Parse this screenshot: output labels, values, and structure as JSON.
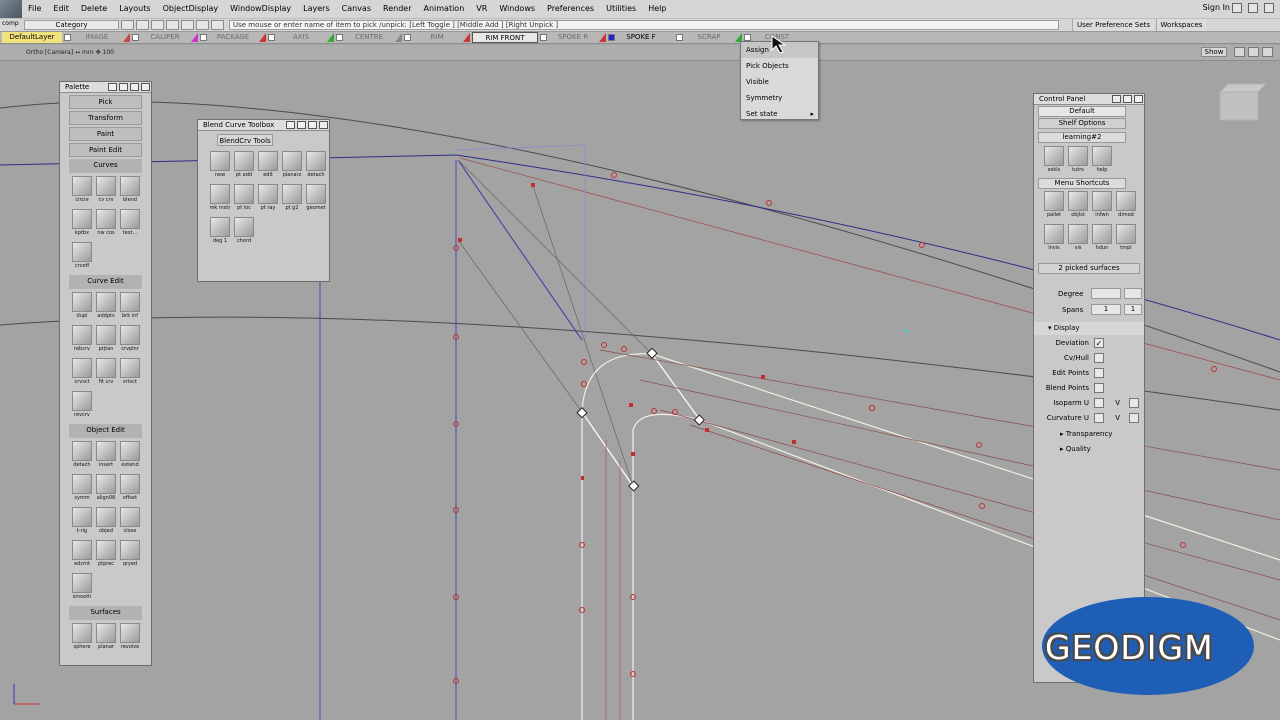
{
  "menubar": {
    "items": [
      "File",
      "Edit",
      "Delete",
      "Layouts",
      "ObjectDisplay",
      "WindowDisplay",
      "Layers",
      "Canvas",
      "Render",
      "Animation",
      "VR",
      "Windows",
      "Preferences",
      "Utilities",
      "Help"
    ],
    "sign_in": "Sign In"
  },
  "toolbar": {
    "comp_label": "comp",
    "category": "Category",
    "hint": "Use mouse or enter name of item to pick /unpick: [Left Toggle ] [Middle Add ] [Right Unpick ]",
    "user_pref_sets": "User Preference Sets",
    "workspaces": "Workspaces"
  },
  "layers": [
    {
      "label": "DefaultLayer",
      "color": "#f2e27b"
    },
    {
      "label": "IMAGE",
      "color": "#c44"
    },
    {
      "label": "CALIPER",
      "color": "#c3c"
    },
    {
      "label": "PACKAGE",
      "color": "#c33"
    },
    {
      "label": "AXIS",
      "color": "#3a3"
    },
    {
      "label": "CENTRE",
      "color": "#888"
    },
    {
      "label": "RIM",
      "color": "#c33"
    },
    {
      "label": "RIM FRONT",
      "color": "#888"
    },
    {
      "label": "SPOKE R",
      "color": "#c33"
    },
    {
      "label": "SPOKE F",
      "color": "#22c"
    },
    {
      "label": "SCRAP",
      "color": "#3a3"
    },
    {
      "label": "CONST",
      "color": "#888"
    }
  ],
  "viewport": {
    "label": "Ortho [Camera]",
    "units": "mm",
    "zoom": "100",
    "show": "Show"
  },
  "popup": {
    "items": [
      "Assign",
      "Pick Objects",
      "Visible",
      "Symmetry",
      "Set state"
    ]
  },
  "palette": {
    "title": "Palette",
    "buttons": [
      "Pick",
      "Transform",
      "Paint",
      "Paint Edit"
    ],
    "sections": [
      {
        "header": "Curves",
        "icons": [
          "circle",
          "cv crv",
          "blend",
          "kptbx",
          "nw cos",
          "text...",
          "crvoff"
        ]
      },
      {
        "header": "Curve Edit",
        "icons": [
          "dupl",
          "addpts",
          "brk inf",
          "rebcrv",
          "prjtan",
          "crvplnr",
          "crvsct",
          "fit crv",
          "srtsct",
          "revcrv"
        ]
      },
      {
        "header": "Object Edit",
        "icons": [
          "detach",
          "insert",
          "extend",
          "symm",
          "align08",
          "offset",
          "t-rig",
          "objed",
          "close",
          "edcmt",
          "ptprec",
          "qryed",
          "smooth"
        ]
      },
      {
        "header": "Surfaces",
        "icons": [
          "sphere",
          "planar",
          "revolve"
        ]
      }
    ]
  },
  "blend_toolbox": {
    "title": "Blend Curve Toolbox",
    "tab": "BlendCrv Tools",
    "icons": [
      "new",
      "pt add",
      "edit",
      "planarz",
      "detach",
      "mk mstr",
      "pt loc",
      "pt ray",
      "pt g2",
      "geomet",
      "deg 1",
      "chord"
    ]
  },
  "control_panel": {
    "title": "Control Panel",
    "preset": "Default",
    "shelf_options": "Shelf Options",
    "shelf_tab": "learning#2",
    "top_icons": [
      "eskls",
      "tutrs",
      "help"
    ],
    "menu_shortcuts": "Menu Shortcuts",
    "shortcut_icons": [
      "pallet",
      "objlst",
      "infwn",
      "dimod",
      "invis",
      "vis",
      "hdun",
      "tmpl"
    ],
    "picked": "2 picked surfaces",
    "degree_label": "Degree",
    "spans_label": "Spans",
    "spans_u": "1",
    "spans_v": "1",
    "display_header": "Display",
    "display_rows": [
      {
        "label": "Deviation",
        "checked": "✓"
      },
      {
        "label": "Cv/Hull",
        "checked": ""
      },
      {
        "label": "Edit Points",
        "checked": ""
      },
      {
        "label": "Blend Points",
        "checked": ""
      },
      {
        "label": "Isoparm U",
        "checked": "",
        "v": "V"
      },
      {
        "label": "Curvature U",
        "checked": "",
        "v": "V"
      }
    ],
    "transparency": "Transparency",
    "quality": "Quality"
  },
  "watermark": {
    "text": "GEODIGM",
    "color": "#1f5eb7"
  }
}
